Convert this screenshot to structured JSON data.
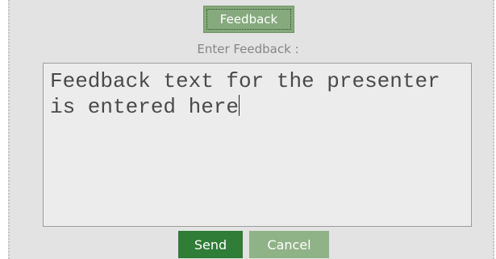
{
  "header": {
    "tab_label": "Feedback"
  },
  "form": {
    "prompt_label": "Enter Feedback :",
    "feedback_value": "Feedback text for the presenter\nis entered here"
  },
  "actions": {
    "send_label": "Send",
    "cancel_label": "Cancel"
  },
  "colors": {
    "panel_bg": "#e3e3e3",
    "tab_bg": "#86a97d",
    "send_bg": "#2f7d36",
    "cancel_bg": "#8fb287",
    "label_text": "#858585"
  }
}
